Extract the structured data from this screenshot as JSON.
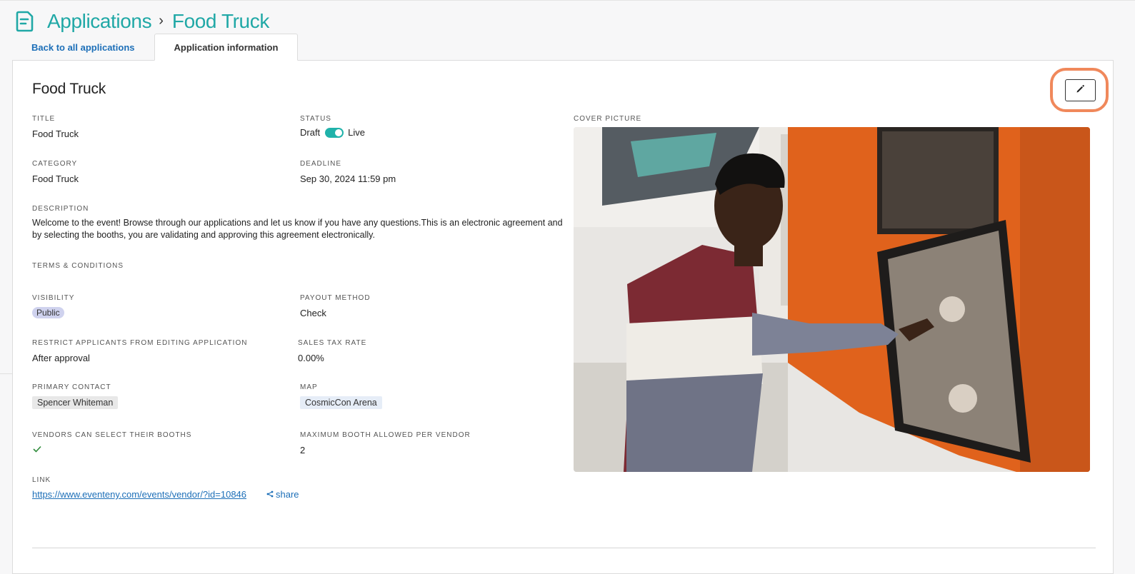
{
  "header": {
    "icon": "document-icon",
    "breadcrumb_root": "Applications",
    "breadcrumb_current": "Food Truck"
  },
  "tabs": [
    {
      "label": "Back to all applications"
    },
    {
      "label": "Application information",
      "active": true
    }
  ],
  "application": {
    "name": "Food Truck",
    "title_label": "TITLE",
    "title_value": "Food Truck",
    "status_label": "STATUS",
    "status_off": "Draft",
    "status_on": "Live",
    "status_live": true,
    "category_label": "CATEGORY",
    "category_value": "Food Truck",
    "deadline_label": "DEADLINE",
    "deadline_value": "Sep 30, 2024 11:59 pm",
    "description_label": "DESCRIPTION",
    "description_value": "Welcome to the event! Browse through our applications and let us know if you have any questions.This is an electronic agreement and by selecting the booths, you are validating and approving this agreement electronically.",
    "terms_label": "TERMS & CONDITIONS",
    "visibility_label": "VISIBILITY",
    "visibility_value": "Public",
    "payout_label": "PAYOUT METHOD",
    "payout_value": "Check",
    "restrict_label": "RESTRICT APPLICANTS FROM EDITING APPLICATION",
    "restrict_value": "After approval",
    "tax_label": "SALES TAX RATE",
    "tax_value": "0.00%",
    "contact_label": "PRIMARY CONTACT",
    "contact_value": "Spencer Whiteman",
    "map_label": "MAP",
    "map_value": "CosmicCon Arena",
    "vendors_select_label": "VENDORS CAN SELECT THEIR BOOTHS",
    "vendors_select_value": true,
    "max_booth_label": "MAXIMUM BOOTH ALLOWED PER VENDOR",
    "max_booth_value": "2",
    "link_label": "LINK",
    "link_value": "https://www.eventeny.com/events/vendor/?id=10846",
    "share_label": "share",
    "cover_label": "COVER PICTURE"
  },
  "colors": {
    "accent": "#20a8a6",
    "link": "#1d6fb8",
    "highlight_ring": "#f0885b",
    "truck_orange": "#e0621c"
  }
}
